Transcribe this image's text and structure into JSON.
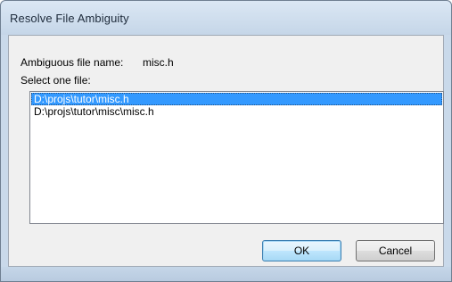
{
  "window": {
    "title": "Resolve File Ambiguity"
  },
  "dialog": {
    "ambiguous_label": "Ambiguous file name:",
    "ambiguous_value": "misc.h",
    "select_label": "Select one file:",
    "files": [
      {
        "path": "D:\\projs\\tutor\\misc.h",
        "selected": true
      },
      {
        "path": "D:\\projs\\tutor\\misc\\misc.h",
        "selected": false
      }
    ]
  },
  "buttons": {
    "ok_label": "OK",
    "cancel_label": "Cancel"
  }
}
